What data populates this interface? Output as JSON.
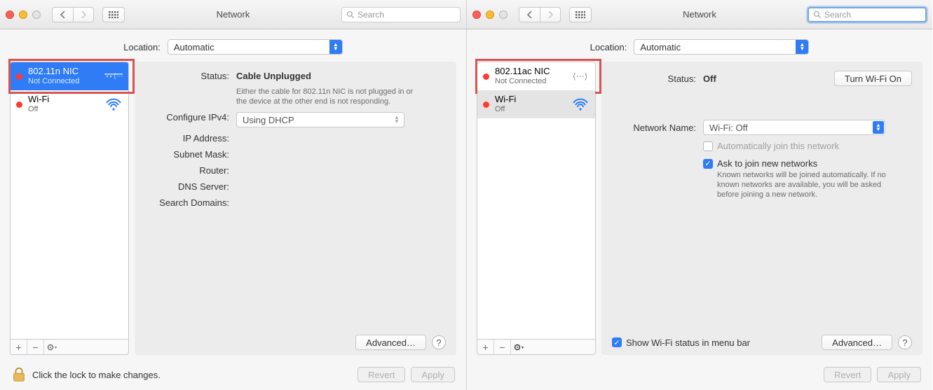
{
  "left": {
    "toolbar": {
      "title": "Network",
      "search_placeholder": "Search"
    },
    "location": {
      "label": "Location:",
      "value": "Automatic"
    },
    "sidebar": {
      "items": [
        {
          "name": "802.11n NIC",
          "status": "Not Connected"
        },
        {
          "name": "Wi-Fi",
          "status": "Off"
        }
      ]
    },
    "detail": {
      "status_label": "Status:",
      "status_value": "Cable Unplugged",
      "status_sub": "Either the cable for 802.11n NIC is not plugged in or the device at the other end is not responding.",
      "configure_label": "Configure IPv4:",
      "configure_value": "Using DHCP",
      "ip_label": "IP Address:",
      "subnet_label": "Subnet Mask:",
      "router_label": "Router:",
      "dns_label": "DNS Server:",
      "search_domains_label": "Search Domains:",
      "advanced": "Advanced…"
    },
    "bottom": {
      "lock_text": "Click the lock to make changes.",
      "revert": "Revert",
      "apply": "Apply"
    }
  },
  "right": {
    "toolbar": {
      "title": "Network",
      "search_placeholder": "Search"
    },
    "location": {
      "label": "Location:",
      "value": "Automatic"
    },
    "sidebar": {
      "items": [
        {
          "name": "802.11ac NIC",
          "status": "Not Connected"
        },
        {
          "name": "Wi-Fi",
          "status": "Off"
        }
      ]
    },
    "detail": {
      "status_label": "Status:",
      "status_value": "Off",
      "turn_on": "Turn Wi-Fi On",
      "network_name_label": "Network Name:",
      "network_name_value": "Wi-Fi: Off",
      "auto_join": "Automatically join this network",
      "ask_join": "Ask to join new networks",
      "ask_sub": "Known networks will be joined automatically. If no known networks are available, you will be asked before joining a new network.",
      "show_status": "Show Wi-Fi status in menu bar",
      "advanced": "Advanced…"
    },
    "bottom": {
      "revert": "Revert",
      "apply": "Apply"
    }
  }
}
